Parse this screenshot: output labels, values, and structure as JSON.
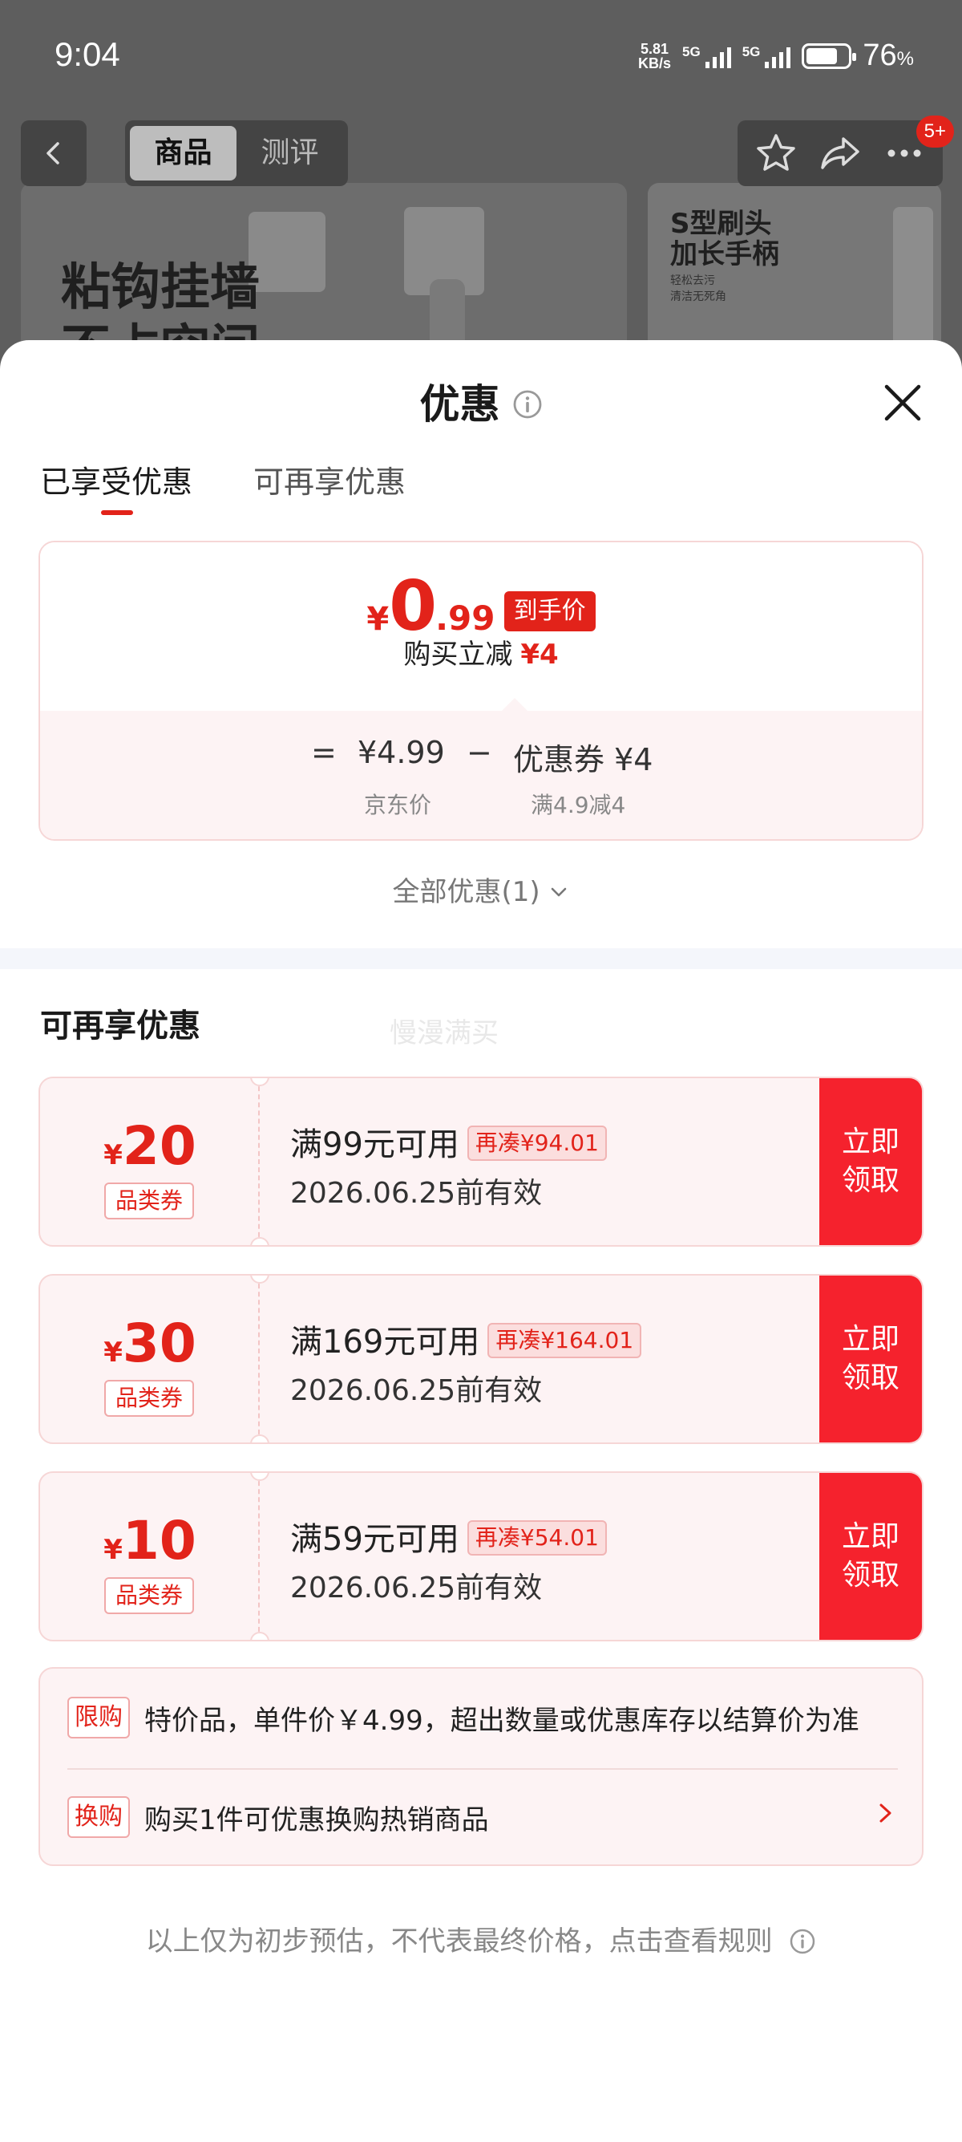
{
  "status_bar": {
    "time": "9:04",
    "net_speed_value": "5.81",
    "net_speed_unit": "KB/s",
    "signal1_label": "5G",
    "signal2_label": "5G",
    "battery_level": 0.76,
    "battery_percent": "76",
    "battery_percent_sign": "%"
  },
  "background_page": {
    "tabs": [
      "商品",
      "测评"
    ],
    "active_tab": "商品",
    "more_badge": "5+",
    "banner_left_text": [
      "粘钩挂墙",
      "不占空间"
    ],
    "banner_right_title": [
      "S型刷头",
      "加长手柄"
    ],
    "banner_right_sub": [
      "轻松去污",
      "清洁无死角"
    ],
    "icons": [
      "back-icon",
      "star-icon",
      "share-icon",
      "more-icon"
    ]
  },
  "sheet": {
    "title": "优惠",
    "tabs": {
      "enjoyed": "已享受优惠",
      "available": "可再享优惠"
    },
    "price_card": {
      "yen": "¥",
      "price_int": "0",
      "price_dec": ".99",
      "price_tag": "到手价",
      "reduce_label": "购买立减",
      "reduce_amount": "¥4",
      "eq": "=",
      "jd_price": "¥4.99",
      "minus": "−",
      "coupon_text": "优惠券 ¥4",
      "jd_price_caption": "京东价",
      "coupon_caption": "满4.9减4"
    },
    "all_offers": "全部优惠(1)",
    "section_title": "可再享优惠",
    "watermark": "慢漫满买",
    "coupons": [
      {
        "yen": "¥",
        "amount": "20",
        "type": "品类券",
        "condition": "满99元可用",
        "need": "再凑¥94.01",
        "valid": "2026.06.25前有效",
        "claim_line1": "立即",
        "claim_line2": "领取"
      },
      {
        "yen": "¥",
        "amount": "30",
        "type": "品类券",
        "condition": "满169元可用",
        "need": "再凑¥164.01",
        "valid": "2026.06.25前有效",
        "claim_line1": "立即",
        "claim_line2": "领取"
      },
      {
        "yen": "¥",
        "amount": "10",
        "type": "品类券",
        "condition": "满59元可用",
        "need": "再凑¥54.01",
        "valid": "2026.06.25前有效",
        "claim_line1": "立即",
        "claim_line2": "领取"
      }
    ],
    "notes": [
      {
        "tag": "限购",
        "text": "特价品，单件价￥4.99，超出数量或优惠库存以结算价为准"
      },
      {
        "tag": "换购",
        "text": "购买1件可优惠换购热销商品"
      }
    ],
    "disclaimer": "以上仅为初步预估，不代表最终价格，点击查看规则"
  },
  "colors": {
    "accent_red": "#e2231a",
    "claim_red": "#f5222d",
    "card_pink": "#fdf3f4"
  }
}
